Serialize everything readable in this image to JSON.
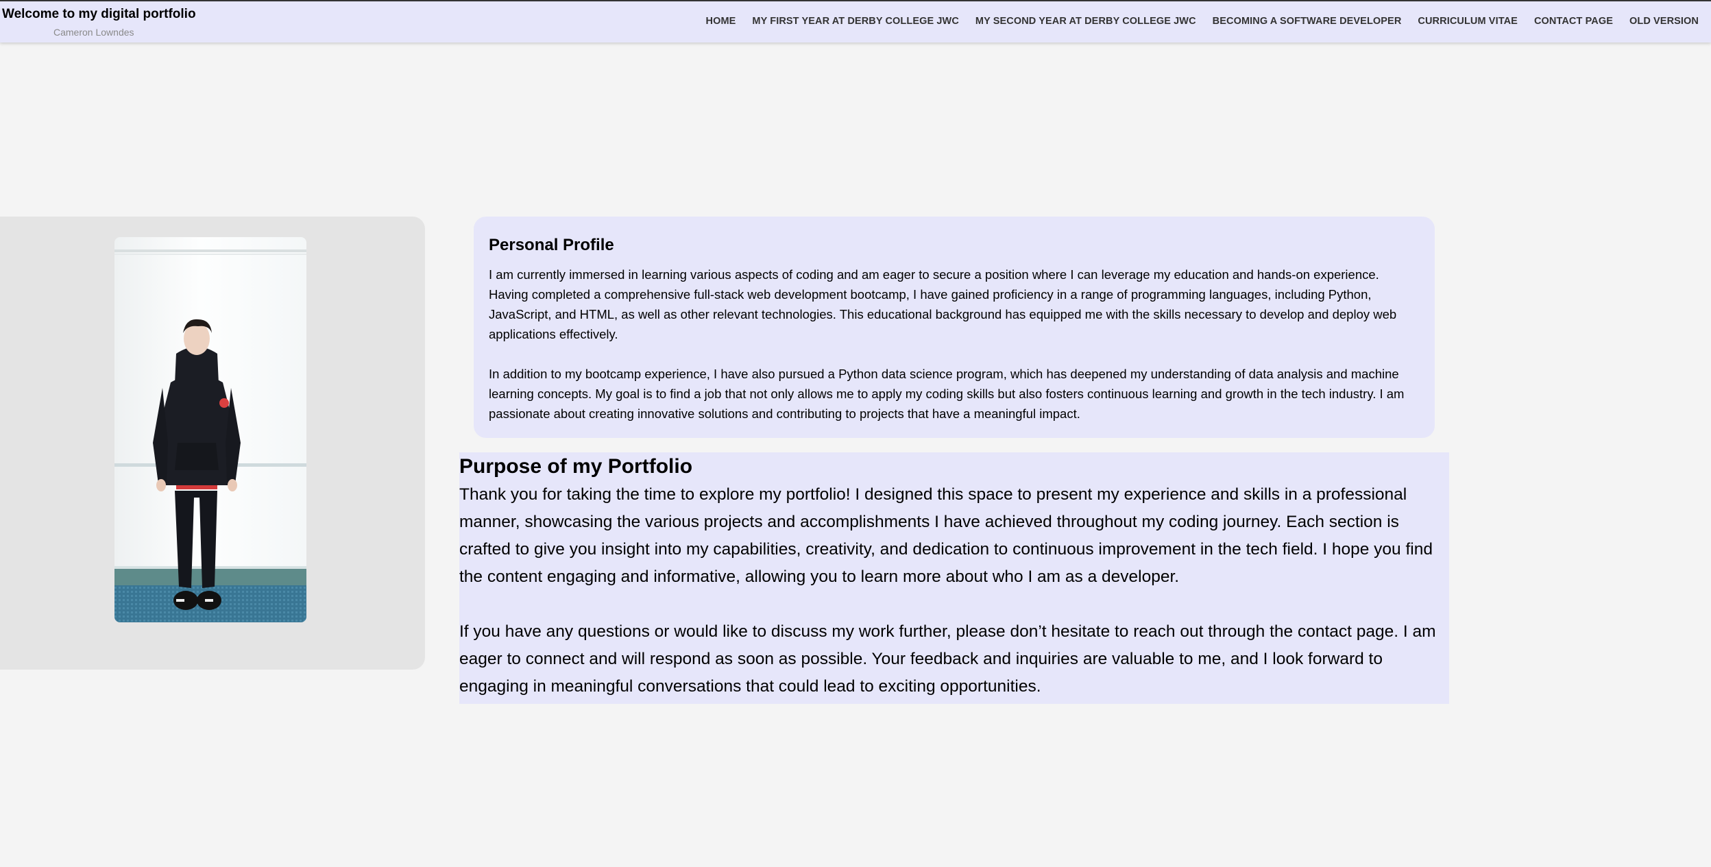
{
  "header": {
    "title": "Welcome to my digital portfolio",
    "subtitle": "Cameron Lowndes",
    "background_color": "#e6e6fa"
  },
  "nav": {
    "items": [
      {
        "label": "HOME"
      },
      {
        "label": "MY FIRST YEAR AT DERBY COLLEGE JWC"
      },
      {
        "label": "MY SECOND YEAR AT DERBY COLLEGE JWC"
      },
      {
        "label": "BECOMING A SOFTWARE DEVELOPER"
      },
      {
        "label": "CURRICULUM VITAE"
      },
      {
        "label": "CONTACT PAGE"
      },
      {
        "label": "OLD VERSION"
      }
    ]
  },
  "photo": {
    "icon": "profile-photo"
  },
  "profile": {
    "heading": "Personal Profile",
    "paragraphs": [
      "I am currently immersed in learning various aspects of coding and am eager to secure a position where I can leverage my education and hands-on experience. Having completed a comprehensive full-stack web development bootcamp, I have gained proficiency in a range of programming languages, including Python, JavaScript, and HTML, as well as other relevant technologies. This educational background has equipped me with the skills necessary to develop and deploy web applications effectively.",
      "In addition to my bootcamp experience, I have also pursued a Python data science program, which has deepened my understanding of data analysis and machine learning concepts. My goal is to find a job that not only allows me to apply my coding skills but also fosters continuous learning and growth in the tech industry. I am passionate about creating innovative solutions and contributing to projects that have a meaningful impact."
    ]
  },
  "purpose": {
    "heading": "Purpose of my Portfolio",
    "paragraphs": [
      "Thank you for taking the time to explore my portfolio! I designed this space to present my experience and skills in a professional manner, showcasing the various projects and accomplishments I have achieved throughout my coding journey. Each section is crafted to give you insight into my capabilities, creativity, and dedication to continuous improvement in the tech field. I hope you find the content engaging and informative, allowing you to learn more about who I am as a developer.",
      "If you have any questions or would like to discuss my work further, please don’t hesitate to reach out through the contact page. I am eager to connect and will respond as soon as possible. Your feedback and inquiries are valuable to me, and I look forward to engaging in meaningful conversations that could lead to exciting opportunities."
    ]
  }
}
